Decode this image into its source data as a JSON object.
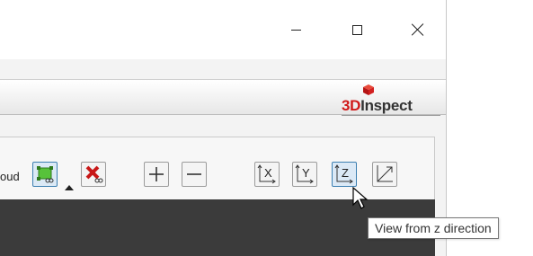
{
  "window": {
    "controls": {
      "minimize_icon": "minimize-icon",
      "maximize_icon": "maximize-icon",
      "close_icon": "close-icon"
    }
  },
  "header": {
    "logo_red": "3D",
    "logo_gray": "Inspect",
    "brand_red": "#d01818"
  },
  "toolbar": {
    "partial_label": "oud",
    "buttons": [
      {
        "name": "select-green-icon"
      },
      {
        "name": "remove-red-x-icon"
      },
      {
        "name": "plus-icon"
      },
      {
        "name": "minus-icon"
      },
      {
        "label": "X"
      },
      {
        "label": "Y"
      },
      {
        "label": "Z"
      },
      {
        "name": "view-iso-icon"
      }
    ]
  },
  "tooltip": {
    "text": "View from z direction"
  },
  "colors": {
    "viewport_bg": "#3b3b3b",
    "active_button_border": "#3c7fb1"
  }
}
